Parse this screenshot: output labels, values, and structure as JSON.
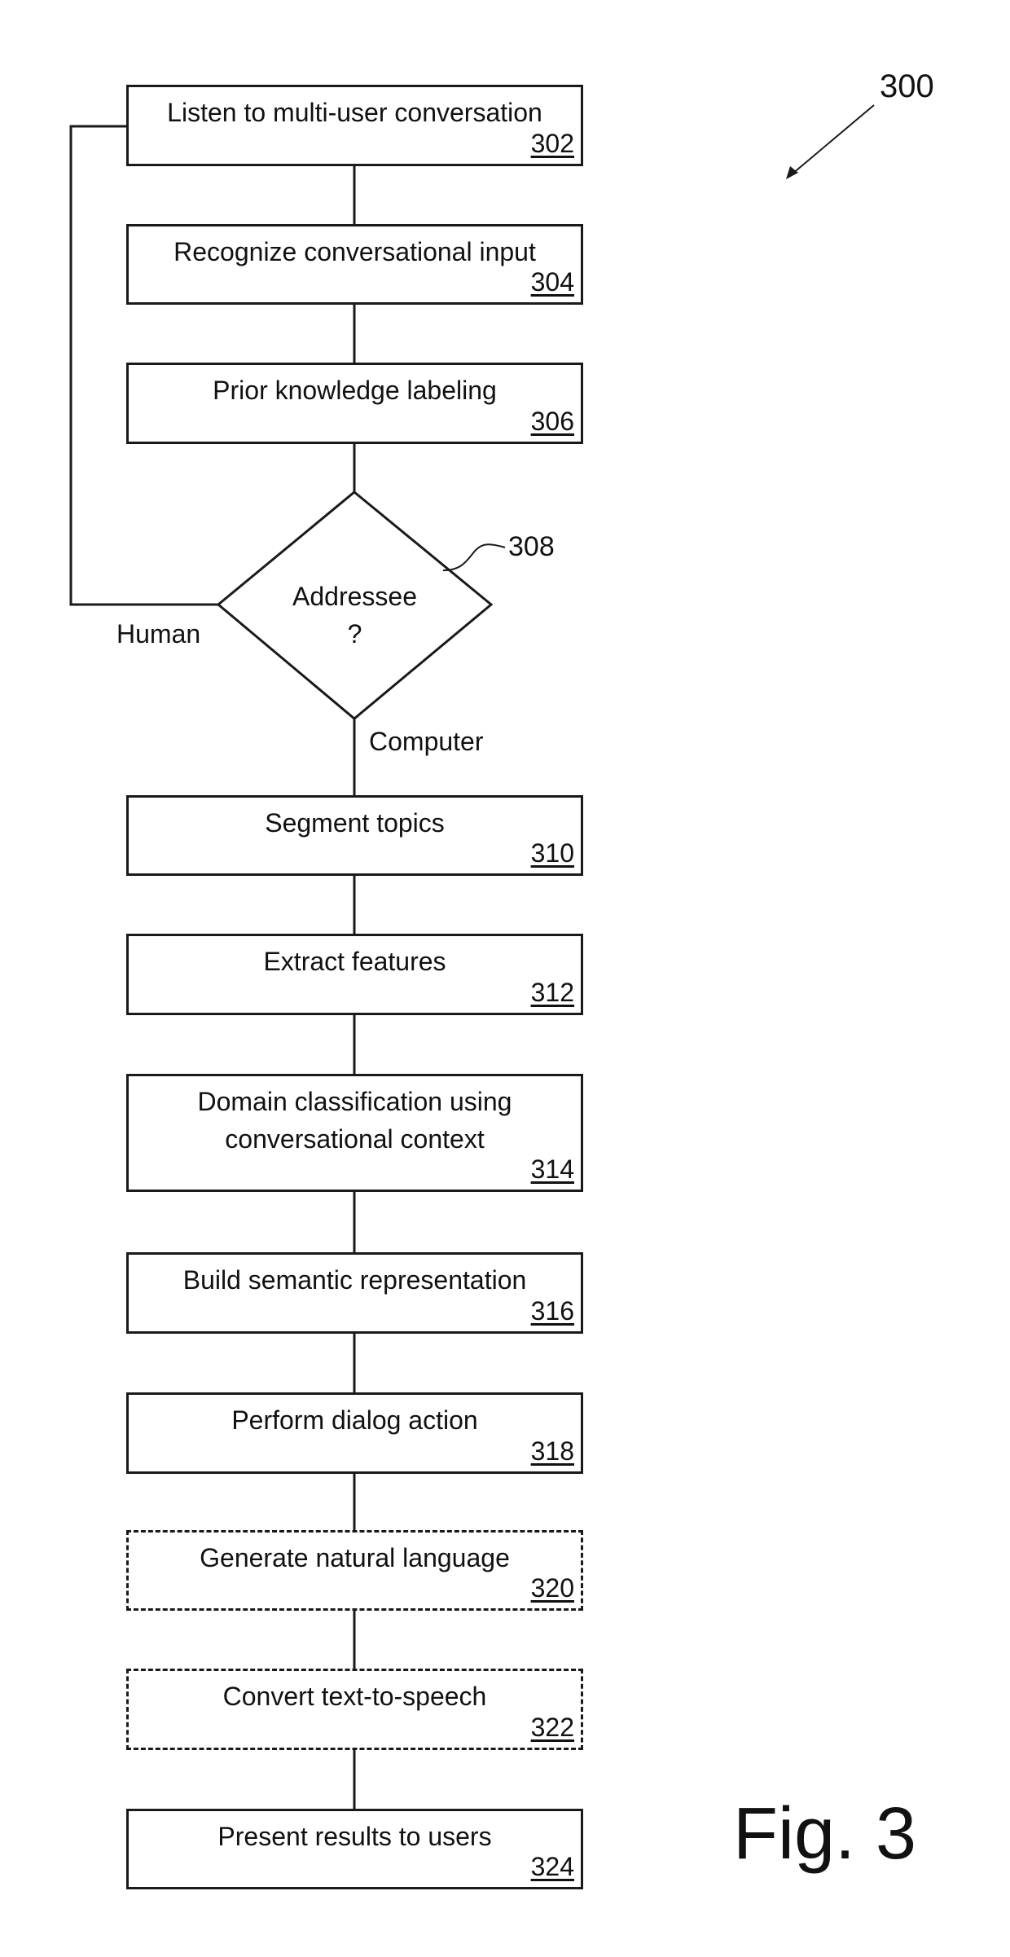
{
  "figure": {
    "label": "Fig. 3",
    "reference": "300"
  },
  "steps": [
    {
      "id": "302",
      "text": "Listen to multi-user conversation",
      "style": "solid"
    },
    {
      "id": "304",
      "text": "Recognize conversational input",
      "style": "solid"
    },
    {
      "id": "306",
      "text": "Prior knowledge labeling",
      "style": "solid"
    },
    {
      "id": "310",
      "text": "Segment topics",
      "style": "solid"
    },
    {
      "id": "312",
      "text": "Extract features",
      "style": "solid"
    },
    {
      "id": "314",
      "text": "Domain classification using conversational context",
      "style": "solid"
    },
    {
      "id": "316",
      "text": "Build semantic representation",
      "style": "solid"
    },
    {
      "id": "318",
      "text": "Perform dialog action",
      "style": "solid"
    },
    {
      "id": "320",
      "text": "Generate natural language",
      "style": "dashed"
    },
    {
      "id": "322",
      "text": "Convert text-to-speech",
      "style": "dashed"
    },
    {
      "id": "324",
      "text": "Present results to users",
      "style": "solid"
    }
  ],
  "decision": {
    "id": "308",
    "line1": "Addressee",
    "line2": "?",
    "branch_human": "Human",
    "branch_computer": "Computer"
  }
}
